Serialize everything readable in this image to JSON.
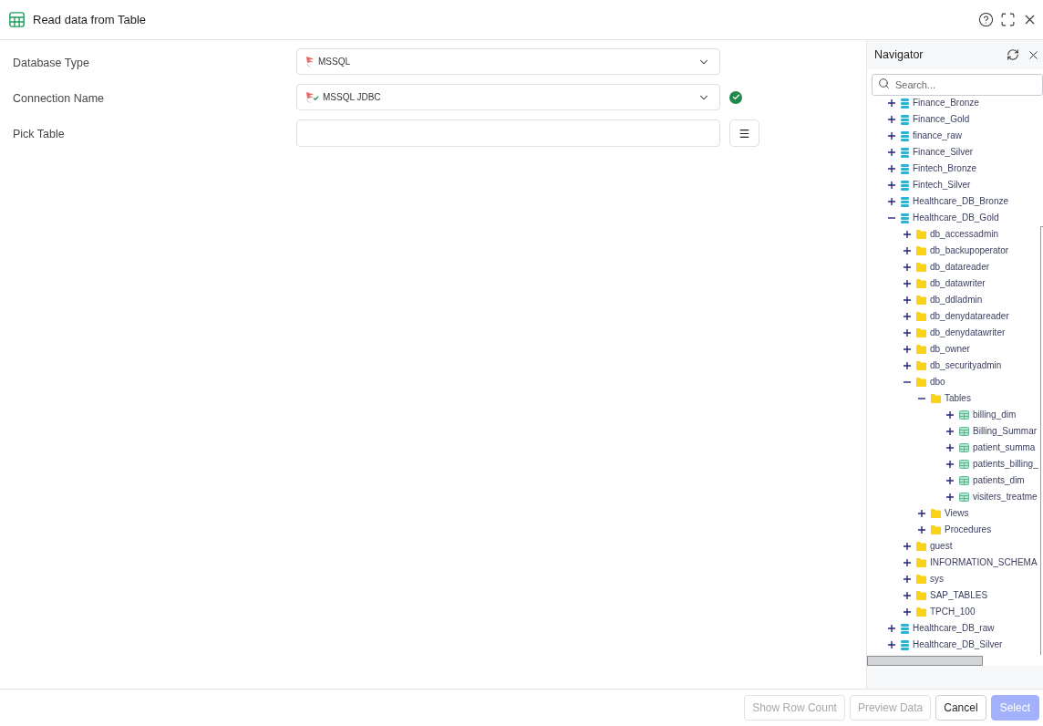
{
  "dialog": {
    "title": "Read data from Table"
  },
  "form": {
    "fields": [
      {
        "kind": "dbtype",
        "label": "Database Type",
        "value": "MSSQL",
        "verified": false
      },
      {
        "kind": "connection",
        "label": "Connection Name",
        "value": "MSSQL JDBC",
        "verified": true
      },
      {
        "kind": "picker",
        "label": "Pick Table",
        "verified": false
      }
    ]
  },
  "navigator": {
    "title": "Navigator",
    "search": {
      "placeholder": "Search..."
    },
    "tree": [
      {
        "kind": "database",
        "label": "Finance_Bronze",
        "expanded": false
      },
      {
        "kind": "database",
        "label": "Finance_Gold",
        "expanded": false
      },
      {
        "kind": "database",
        "label": "finance_raw",
        "expanded": false
      },
      {
        "kind": "database",
        "label": "Finance_Silver",
        "expanded": false
      },
      {
        "kind": "database",
        "label": "Fintech_Bronze",
        "expanded": false
      },
      {
        "kind": "database",
        "label": "Fintech_Silver",
        "expanded": false
      },
      {
        "kind": "database",
        "label": "Healthcare_DB_Bronze",
        "expanded": false
      },
      {
        "kind": "database",
        "label": "Healthcare_DB_Gold",
        "expanded": true,
        "children": [
          {
            "kind": "folder",
            "label": "db_accessadmin",
            "expanded": false
          },
          {
            "kind": "folder",
            "label": "db_backupoperator",
            "expanded": false
          },
          {
            "kind": "folder",
            "label": "db_datareader",
            "expanded": false
          },
          {
            "kind": "folder",
            "label": "db_datawriter",
            "expanded": false
          },
          {
            "kind": "folder",
            "label": "db_ddladmin",
            "expanded": false
          },
          {
            "kind": "folder",
            "label": "db_denydatareader",
            "expanded": false
          },
          {
            "kind": "folder",
            "label": "db_denydatawriter",
            "expanded": false
          },
          {
            "kind": "folder",
            "label": "db_owner",
            "expanded": false
          },
          {
            "kind": "folder",
            "label": "db_securityadmin",
            "expanded": false
          },
          {
            "kind": "folder",
            "label": "dbo",
            "expanded": true,
            "children": [
              {
                "kind": "folder",
                "label": "Tables",
                "expanded": true,
                "children": [
                  {
                    "kind": "table",
                    "label": "billing_dim",
                    "expanded": false
                  },
                  {
                    "kind": "table",
                    "label": "Billing_Summar",
                    "expanded": false
                  },
                  {
                    "kind": "table",
                    "label": "patient_summa",
                    "expanded": false
                  },
                  {
                    "kind": "table",
                    "label": "patients_billing_",
                    "expanded": false
                  },
                  {
                    "kind": "table",
                    "label": "patients_dim",
                    "expanded": false
                  },
                  {
                    "kind": "table",
                    "label": "visiters_treatme",
                    "expanded": false
                  }
                ]
              },
              {
                "kind": "folder",
                "label": "Views",
                "expanded": false
              },
              {
                "kind": "folder",
                "label": "Procedures",
                "expanded": false
              }
            ]
          },
          {
            "kind": "folder",
            "label": "guest",
            "expanded": false
          },
          {
            "kind": "folder",
            "label": "INFORMATION_SCHEMA",
            "expanded": false
          },
          {
            "kind": "folder",
            "label": "sys",
            "expanded": false
          },
          {
            "kind": "folder",
            "label": "SAP_TABLES",
            "expanded": false
          },
          {
            "kind": "folder",
            "label": "TPCH_100",
            "expanded": false
          }
        ]
      },
      {
        "kind": "database",
        "label": "Healthcare_DB_raw",
        "expanded": false
      },
      {
        "kind": "database",
        "label": "Healthcare_DB_Silver",
        "expanded": false
      }
    ]
  },
  "footer": {
    "buttons": [
      {
        "kind": "secondary",
        "label": "Show Row Count",
        "disabled": true
      },
      {
        "kind": "secondary",
        "label": "Preview Data",
        "disabled": true
      },
      {
        "kind": "secondary",
        "label": "Cancel",
        "disabled": false
      },
      {
        "kind": "primary",
        "label": "Select",
        "disabled": true
      }
    ]
  }
}
